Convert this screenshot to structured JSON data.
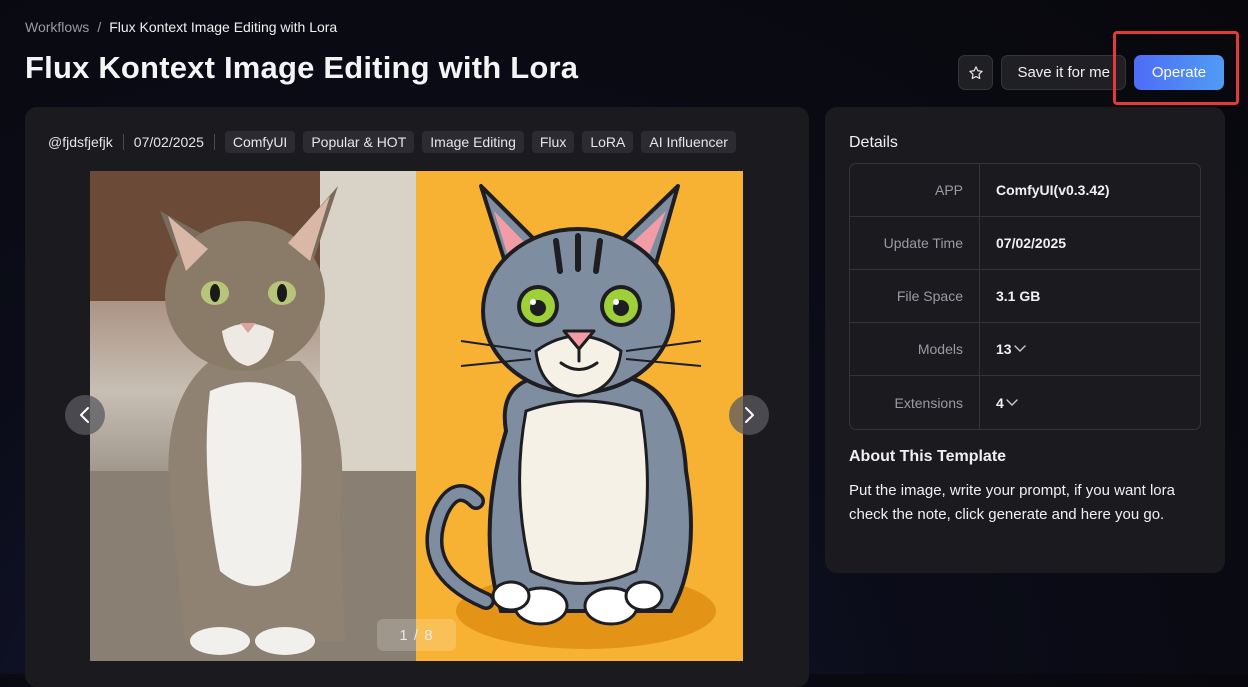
{
  "breadcrumb": {
    "root": "Workflows",
    "separator": "/",
    "current": "Flux Kontext Image Editing with Lora"
  },
  "page": {
    "title": "Flux Kontext Image Editing with Lora"
  },
  "actions": {
    "star_icon": "star-outline-icon",
    "save_label": "Save it for me",
    "operate_label": "Operate"
  },
  "meta": {
    "author": "@fjdsfjefjk",
    "date": "07/02/2025",
    "tags": [
      "ComfyUI",
      "Popular & HOT",
      "Image Editing",
      "Flux",
      "LoRA",
      "AI Influencer"
    ]
  },
  "gallery": {
    "counter": "1 / 8",
    "current": 1,
    "total": 8
  },
  "details": {
    "title": "Details",
    "rows": [
      {
        "key": "APP",
        "value": "ComfyUI(v0.3.42)"
      },
      {
        "key": "Update Time",
        "value": "07/02/2025"
      },
      {
        "key": "File Space",
        "value": "3.1 GB"
      },
      {
        "key": "Models",
        "value": "13"
      },
      {
        "key": "Extensions",
        "value": "4"
      }
    ]
  },
  "about": {
    "title": "About This Template",
    "text": "Put the image, write your prompt, if you want lora check the note, click generate and here you go."
  },
  "colors": {
    "accent": "#4f7cf5",
    "highlight": "#e23a3a",
    "cartoon_bg": "#f7b233"
  }
}
